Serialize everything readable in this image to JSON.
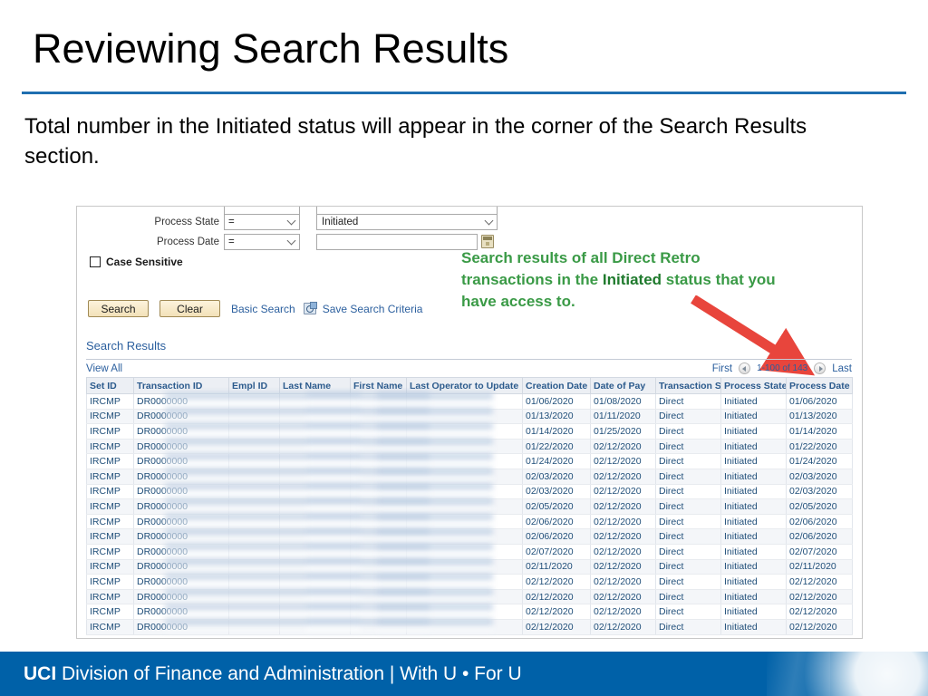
{
  "slide": {
    "title": "Reviewing Search Results",
    "body": "Total number in the Initiated status will appear in the corner of the Search Results section."
  },
  "annotation": {
    "line1": "Search results of all Direct Retro",
    "line2_a": "transactions in the ",
    "line2_b": "Initiated",
    "line2_c": " status that you",
    "line3": "have access to.",
    "color": "#3a9a46",
    "arrow_color": "#e8453c"
  },
  "search_form": {
    "rows": [
      {
        "label": "Process State",
        "operator": "=",
        "value": "Initiated",
        "value_type": "select"
      },
      {
        "label": "Process Date",
        "operator": "=",
        "value": "",
        "value_type": "date"
      }
    ],
    "case_sensitive_label": "Case Sensitive",
    "case_sensitive_checked": false,
    "buttons": {
      "search": "Search",
      "clear": "Clear"
    },
    "links": {
      "basic_search": "Basic Search",
      "save_search_criteria": "Save Search Criteria"
    }
  },
  "results": {
    "heading": "Search Results",
    "view_all": "View All",
    "pager": {
      "first": "First",
      "count": "1-100 of 143",
      "last": "Last"
    },
    "columns": [
      "Set ID",
      "Transaction ID",
      "Empl ID",
      "Last Name",
      "First Name",
      "Last Operator to Update",
      "Creation Date",
      "Date of Pay",
      "Transaction Source",
      "Process State",
      "Process Date"
    ],
    "rows": [
      {
        "set_id": "IRCMP",
        "transaction_id": "DR0000000",
        "empl_id": "",
        "last_name": "",
        "first_name": "",
        "last_operator": "",
        "creation_date": "01/06/2020",
        "date_of_pay": "01/08/2020",
        "source": "Direct",
        "state": "Initiated",
        "process_date": "01/06/2020"
      },
      {
        "set_id": "IRCMP",
        "transaction_id": "DR0000000",
        "empl_id": "",
        "last_name": "",
        "first_name": "",
        "last_operator": "",
        "creation_date": "01/13/2020",
        "date_of_pay": "01/11/2020",
        "source": "Direct",
        "state": "Initiated",
        "process_date": "01/13/2020"
      },
      {
        "set_id": "IRCMP",
        "transaction_id": "DR0000000",
        "empl_id": "",
        "last_name": "",
        "first_name": "",
        "last_operator": "",
        "creation_date": "01/14/2020",
        "date_of_pay": "01/25/2020",
        "source": "Direct",
        "state": "Initiated",
        "process_date": "01/14/2020"
      },
      {
        "set_id": "IRCMP",
        "transaction_id": "DR0000000",
        "empl_id": "",
        "last_name": "",
        "first_name": "",
        "last_operator": "",
        "creation_date": "01/22/2020",
        "date_of_pay": "02/12/2020",
        "source": "Direct",
        "state": "Initiated",
        "process_date": "01/22/2020"
      },
      {
        "set_id": "IRCMP",
        "transaction_id": "DR0000000",
        "empl_id": "",
        "last_name": "",
        "first_name": "",
        "last_operator": "",
        "creation_date": "01/24/2020",
        "date_of_pay": "02/12/2020",
        "source": "Direct",
        "state": "Initiated",
        "process_date": "01/24/2020"
      },
      {
        "set_id": "IRCMP",
        "transaction_id": "DR0000000",
        "empl_id": "",
        "last_name": "",
        "first_name": "",
        "last_operator": "",
        "creation_date": "02/03/2020",
        "date_of_pay": "02/12/2020",
        "source": "Direct",
        "state": "Initiated",
        "process_date": "02/03/2020"
      },
      {
        "set_id": "IRCMP",
        "transaction_id": "DR0000000",
        "empl_id": "",
        "last_name": "",
        "first_name": "",
        "last_operator": "",
        "creation_date": "02/03/2020",
        "date_of_pay": "02/12/2020",
        "source": "Direct",
        "state": "Initiated",
        "process_date": "02/03/2020"
      },
      {
        "set_id": "IRCMP",
        "transaction_id": "DR0000000",
        "empl_id": "",
        "last_name": "",
        "first_name": "",
        "last_operator": "",
        "creation_date": "02/05/2020",
        "date_of_pay": "02/12/2020",
        "source": "Direct",
        "state": "Initiated",
        "process_date": "02/05/2020"
      },
      {
        "set_id": "IRCMP",
        "transaction_id": "DR0000000",
        "empl_id": "",
        "last_name": "",
        "first_name": "",
        "last_operator": "",
        "creation_date": "02/06/2020",
        "date_of_pay": "02/12/2020",
        "source": "Direct",
        "state": "Initiated",
        "process_date": "02/06/2020"
      },
      {
        "set_id": "IRCMP",
        "transaction_id": "DR0000000",
        "empl_id": "",
        "last_name": "",
        "first_name": "",
        "last_operator": "",
        "creation_date": "02/06/2020",
        "date_of_pay": "02/12/2020",
        "source": "Direct",
        "state": "Initiated",
        "process_date": "02/06/2020"
      },
      {
        "set_id": "IRCMP",
        "transaction_id": "DR0000000",
        "empl_id": "",
        "last_name": "",
        "first_name": "",
        "last_operator": "",
        "creation_date": "02/07/2020",
        "date_of_pay": "02/12/2020",
        "source": "Direct",
        "state": "Initiated",
        "process_date": "02/07/2020"
      },
      {
        "set_id": "IRCMP",
        "transaction_id": "DR0000000",
        "empl_id": "",
        "last_name": "",
        "first_name": "",
        "last_operator": "",
        "creation_date": "02/11/2020",
        "date_of_pay": "02/12/2020",
        "source": "Direct",
        "state": "Initiated",
        "process_date": "02/11/2020"
      },
      {
        "set_id": "IRCMP",
        "transaction_id": "DR0000000",
        "empl_id": "",
        "last_name": "",
        "first_name": "",
        "last_operator": "",
        "creation_date": "02/12/2020",
        "date_of_pay": "02/12/2020",
        "source": "Direct",
        "state": "Initiated",
        "process_date": "02/12/2020"
      },
      {
        "set_id": "IRCMP",
        "transaction_id": "DR0000000",
        "empl_id": "",
        "last_name": "",
        "first_name": "",
        "last_operator": "",
        "creation_date": "02/12/2020",
        "date_of_pay": "02/12/2020",
        "source": "Direct",
        "state": "Initiated",
        "process_date": "02/12/2020"
      },
      {
        "set_id": "IRCMP",
        "transaction_id": "DR0000000",
        "empl_id": "",
        "last_name": "",
        "first_name": "",
        "last_operator": "",
        "creation_date": "02/12/2020",
        "date_of_pay": "02/12/2020",
        "source": "Direct",
        "state": "Initiated",
        "process_date": "02/12/2020"
      },
      {
        "set_id": "IRCMP",
        "transaction_id": "DR0000000",
        "empl_id": "",
        "last_name": "",
        "first_name": "",
        "last_operator": "",
        "creation_date": "02/12/2020",
        "date_of_pay": "02/12/2020",
        "source": "Direct",
        "state": "Initiated",
        "process_date": "02/12/2020"
      }
    ]
  },
  "footer": {
    "brand": "UCI",
    "text": " Division of Finance and Administration | With U • For U",
    "background": "#0061a8"
  }
}
